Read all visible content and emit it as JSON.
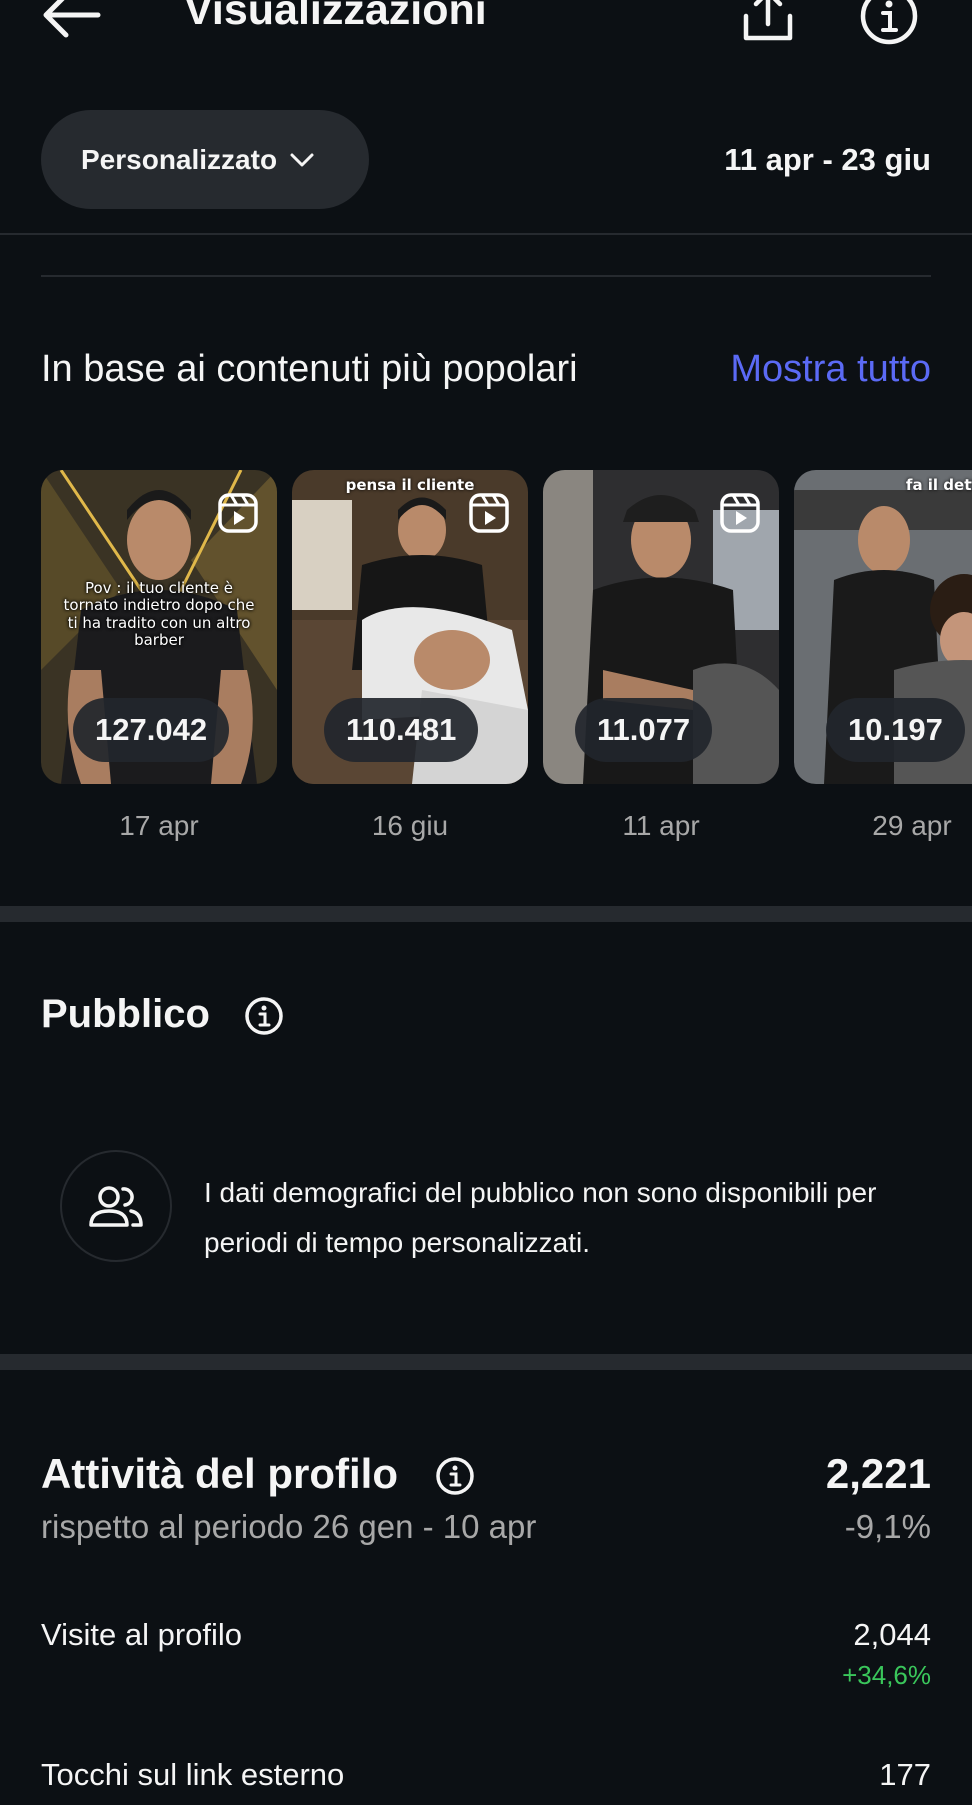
{
  "header": {
    "title": "Visualizzazioni",
    "back_icon": "arrow-left-icon",
    "share_icon": "share-icon",
    "info_icon": "info-icon"
  },
  "filters": {
    "range_selector_label": "Personalizzato",
    "date_range": "11 apr - 23 giu"
  },
  "top_content": {
    "title": "In base ai contenuti più popolari",
    "show_all": "Mostra tutto",
    "items": [
      {
        "views": "127.042",
        "date": "17 apr",
        "caption": "Pov : il tuo cliente è tornato indietro dopo che ti ha tradito con un altro barber",
        "top_caption": ""
      },
      {
        "views": "110.481",
        "date": "16 giu",
        "caption": "",
        "top_caption": "pensa il cliente"
      },
      {
        "views": "11.077",
        "date": "11 apr",
        "caption": "",
        "top_caption": ""
      },
      {
        "views": "10.197",
        "date": "29 apr",
        "caption": "",
        "top_caption": "fa il dettaglio"
      }
    ]
  },
  "audience": {
    "title": "Pubblico",
    "message": "I dati demografici del pubblico non sono disponibili per periodi di tempo personalizzati."
  },
  "profile_activity": {
    "title": "Attività del profilo",
    "total": "2,221",
    "compare_text": "rispetto al periodo 26 gen - 10 apr",
    "total_delta": "-9,1%",
    "rows": [
      {
        "label": "Visite al profilo",
        "value": "2,044",
        "delta": "+34,6%"
      },
      {
        "label": "Tocchi sul link esterno",
        "value": "177",
        "delta": ""
      }
    ]
  },
  "colors": {
    "background": "#0c1014",
    "surface": "#262a2f",
    "accent_link": "#5b6af5",
    "positive": "#3ac65b",
    "muted_text": "#a8a8a8"
  }
}
